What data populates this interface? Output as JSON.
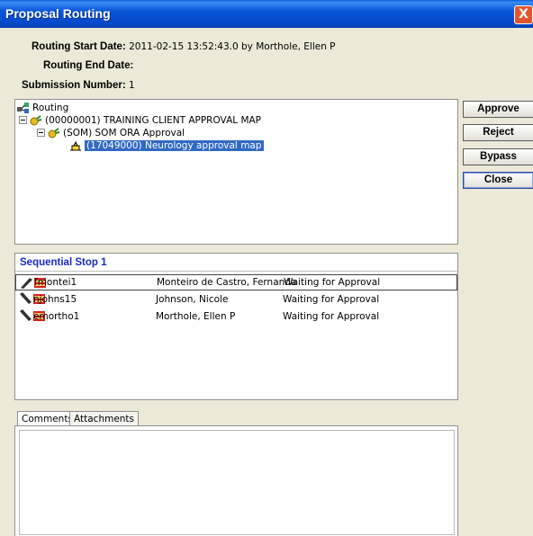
{
  "window": {
    "title": "Proposal Routing",
    "close_glyph": "X"
  },
  "info": {
    "start_label": "Routing Start Date:",
    "start_value": "2011-02-15 13:52:43.0 by Morthole, Ellen P",
    "end_label": "Routing End Date:",
    "end_value": "",
    "submission_label": "Submission Number:",
    "submission_value": "1"
  },
  "tree": {
    "root": "Routing",
    "level1": "(00000001) TRAINING CLIENT APPROVAL MAP",
    "level2": "(SOM) SOM ORA Approval",
    "level3": "(17049000) Neurology approval map"
  },
  "buttons": {
    "approve": "Approve",
    "reject": "Reject",
    "bypass": "Bypass",
    "close": "Close"
  },
  "stop": {
    "title": "Sequential Stop 1",
    "rows": [
      {
        "id": "fmontei1",
        "name": "Monteiro de Castro, Fernanda",
        "status": "Waiting for Approval",
        "icon": "pen-writing-icon"
      },
      {
        "id": "njohns15",
        "name": "Johnson, Nicole",
        "status": "Waiting for Approval",
        "icon": "pen-idle-icon"
      },
      {
        "id": "emortho1",
        "name": "Morthole, Ellen P",
        "status": "Waiting for Approval",
        "icon": "pen-idle-icon"
      }
    ]
  },
  "tabs": {
    "comments": "Comments",
    "attachments": "Attachments"
  },
  "colors": {
    "titlebar": "#0a56d8",
    "selection": "#316ac5",
    "stop_title": "#1c28c8",
    "close_button": "#e2552c"
  }
}
